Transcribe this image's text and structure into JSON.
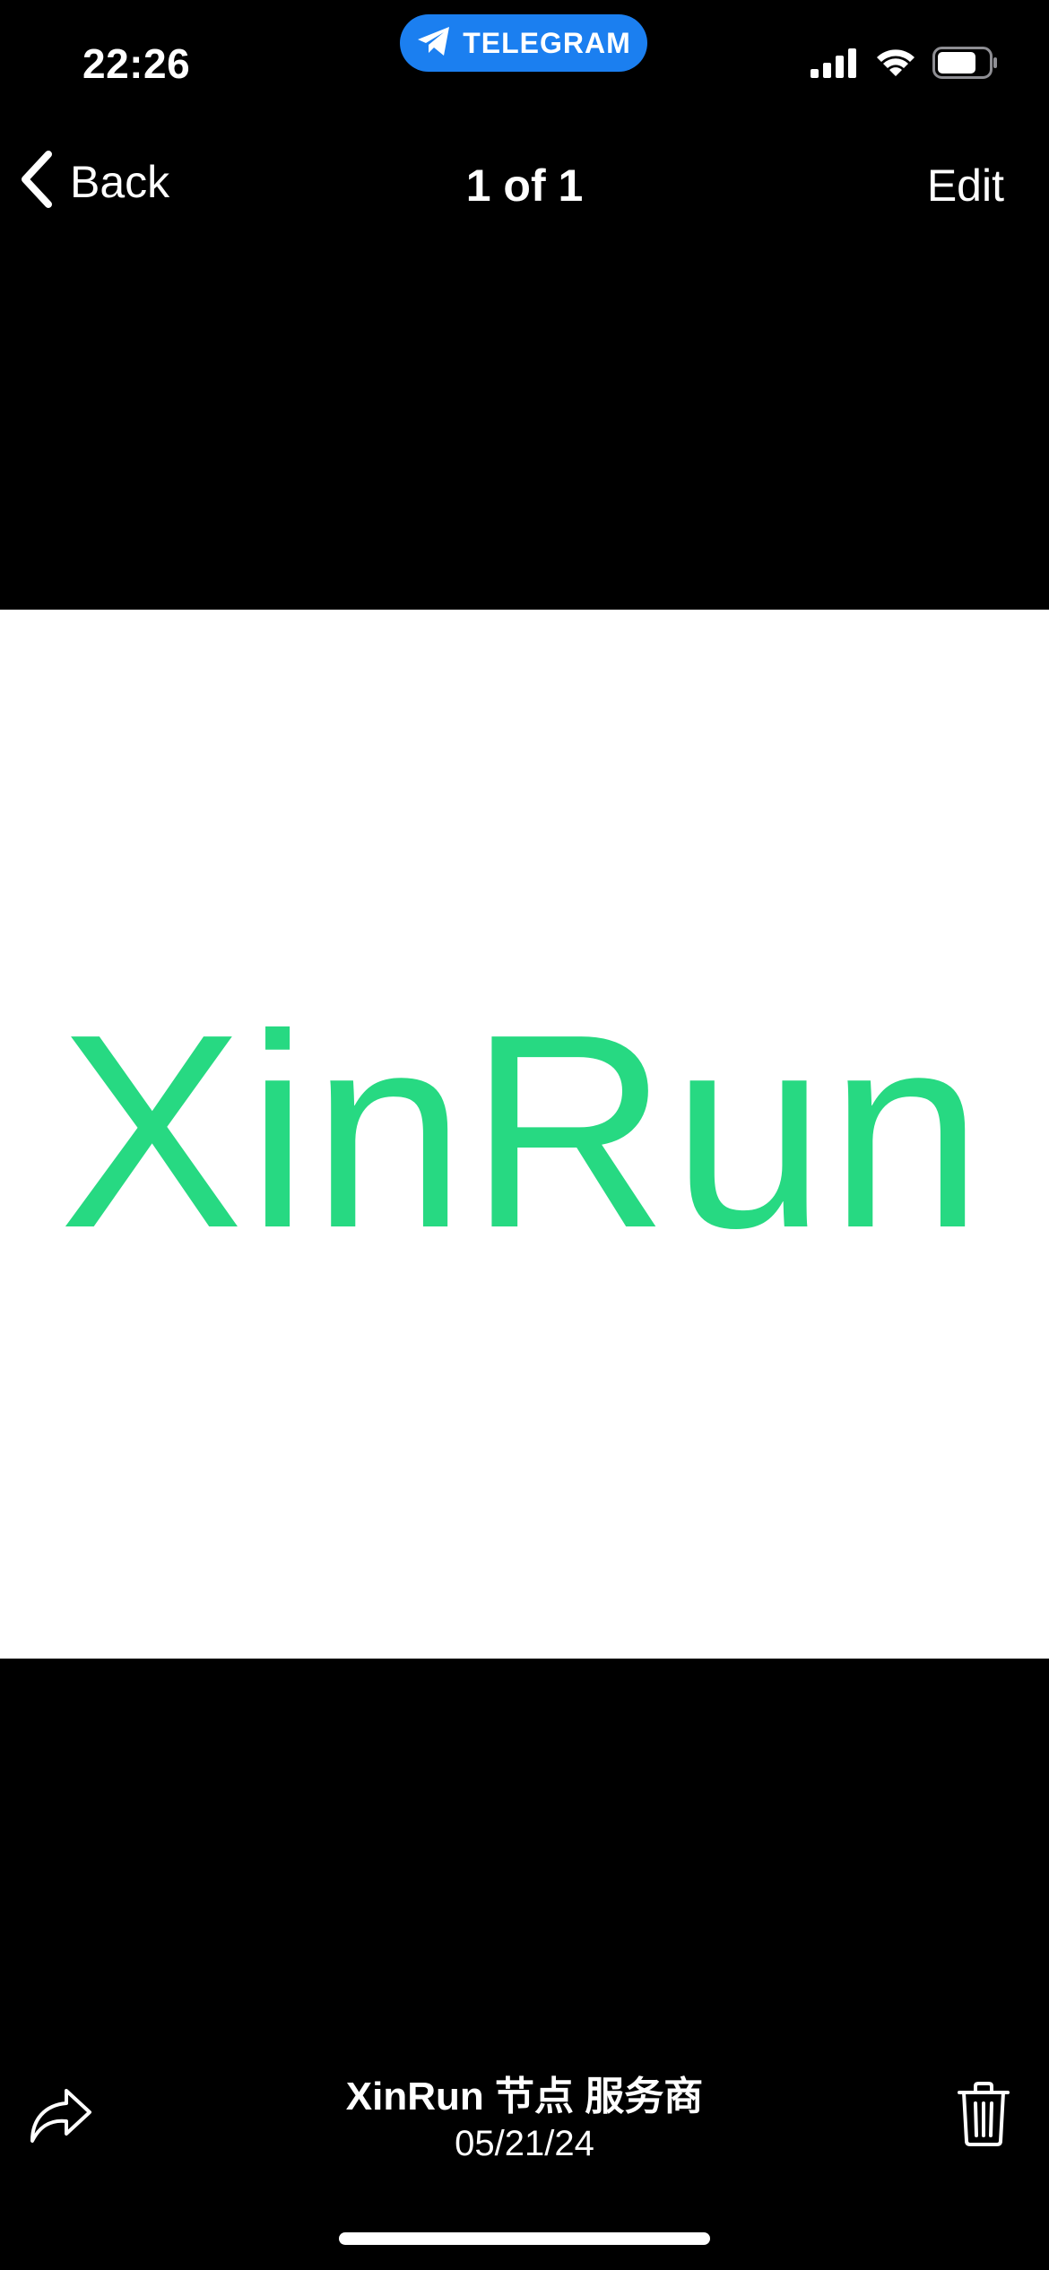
{
  "status_bar": {
    "time": "22:26",
    "return_app": "TELEGRAM"
  },
  "nav": {
    "back_label": "Back",
    "title": "1 of 1",
    "edit_label": "Edit"
  },
  "photo": {
    "logo_text": "XinRun",
    "logo_color": "#27d982"
  },
  "caption": {
    "title": "XinRun 节点 服务商",
    "date": "05/21/24"
  },
  "colors": {
    "background": "#000000",
    "telegram_pill": "#1b7ff0",
    "photo_background": "#ffffff"
  },
  "icons": [
    "telegram-icon",
    "cellular-signal-icon",
    "wifi-icon",
    "battery-icon",
    "chevron-left-icon",
    "share-icon",
    "trash-icon"
  ]
}
